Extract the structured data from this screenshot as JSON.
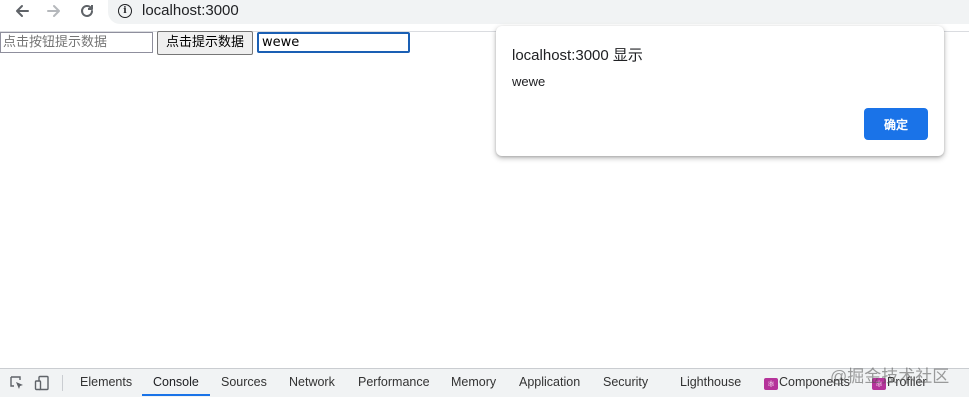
{
  "browser": {
    "url": "localhost:3000",
    "back_icon": "arrow-left",
    "forward_icon": "arrow-right",
    "reload_icon": "reload",
    "info_icon": "info-circle"
  },
  "page": {
    "input_placeholder": "点击按钮提示数据",
    "button_label": "点击提示数据",
    "input2_value": "wewe"
  },
  "dialog": {
    "title": "localhost:3000 显示",
    "message": "wewe",
    "ok_label": "确定",
    "ok_color": "#1a73e8"
  },
  "devtools": {
    "tabs": [
      {
        "label": "Elements"
      },
      {
        "label": "Console",
        "active": true
      },
      {
        "label": "Sources"
      },
      {
        "label": "Network"
      },
      {
        "label": "Performance"
      },
      {
        "label": "Memory"
      },
      {
        "label": "Application"
      },
      {
        "label": "Security"
      },
      {
        "label": "Lighthouse"
      },
      {
        "label": "Components"
      },
      {
        "label": "Profiler"
      }
    ],
    "accent": "#1a73e8"
  },
  "watermark": "@掘金技术社区"
}
